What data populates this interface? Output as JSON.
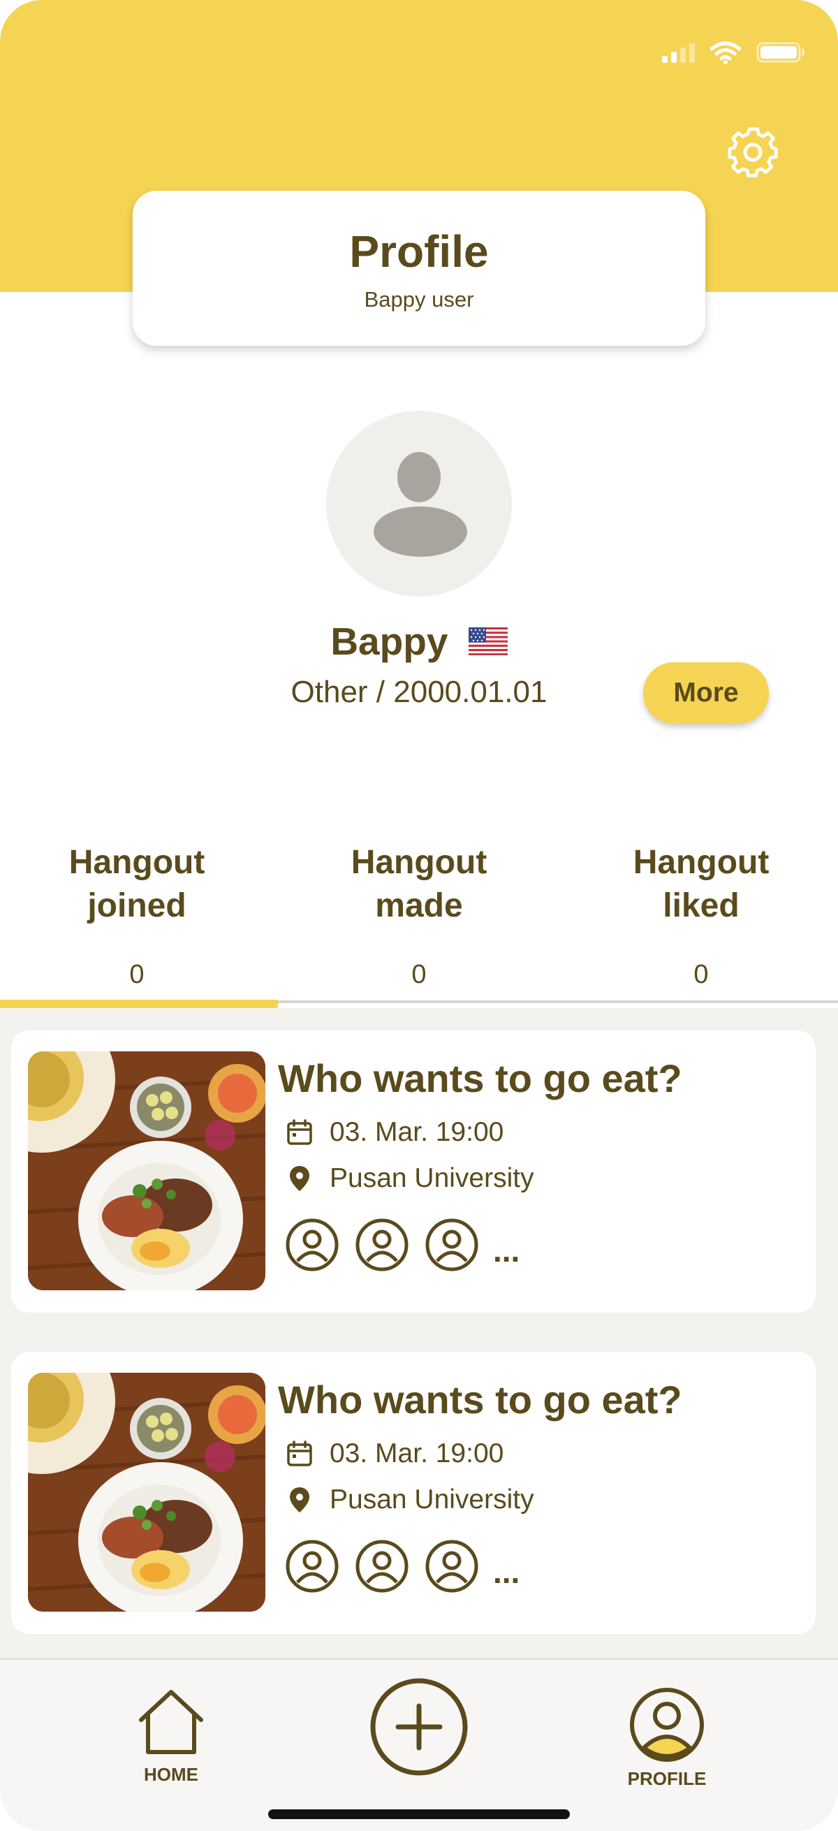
{
  "status_bar": {
    "signal_icon": "cellular-signal-icon",
    "wifi_icon": "wifi-icon",
    "battery_icon": "battery-icon"
  },
  "header": {
    "title": "Profile",
    "subtitle": "Bappy user",
    "settings_icon": "gear-icon",
    "band_color": "#f6d453"
  },
  "profile": {
    "name": "Bappy",
    "flag_icon": "us-flag-icon",
    "gender_birth": "Other / 2000.01.01",
    "more_label": "More"
  },
  "stats": [
    {
      "label_line1": "Hangout",
      "label_line2": "joined",
      "value": "0"
    },
    {
      "label_line1": "Hangout",
      "label_line2": "made",
      "value": "0"
    },
    {
      "label_line1": "Hangout",
      "label_line2": "liked",
      "value": "0"
    }
  ],
  "hangouts": [
    {
      "title": "Who wants to go eat?",
      "datetime": "03. Mar. 19:00",
      "location": "Pusan University",
      "more": "..."
    },
    {
      "title": "Who wants to go eat?",
      "datetime": "03. Mar. 19:00",
      "location": "Pusan University",
      "more": "..."
    }
  ],
  "nav": {
    "home_label": "HOME",
    "profile_label": "PROFILE",
    "add_icon": "plus-circle-icon"
  },
  "colors": {
    "accent": "#f6d453",
    "text": "#5a4a1c",
    "list_bg": "#f3f2ee"
  }
}
